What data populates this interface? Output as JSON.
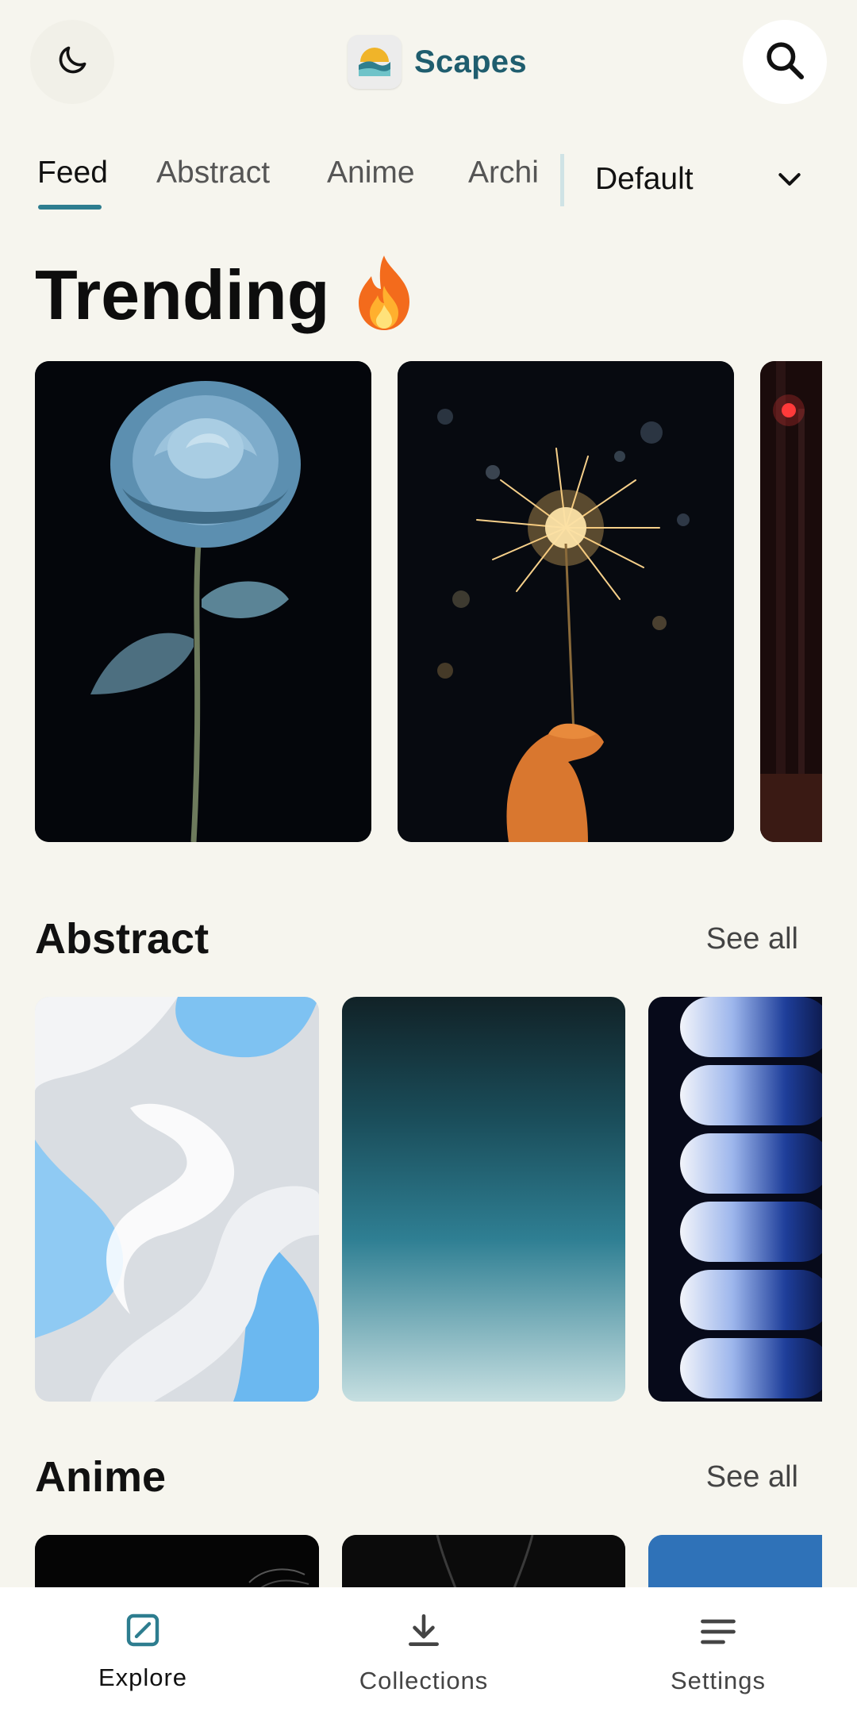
{
  "app": {
    "name": "Scapes",
    "accent": "#2d7d8f",
    "brand_color": "#1f5d6e"
  },
  "header": {
    "theme_toggle_icon": "moon-icon",
    "search_icon": "search-icon"
  },
  "tabs": {
    "items": [
      {
        "label": "Feed",
        "active": true
      },
      {
        "label": "Abstract",
        "active": false
      },
      {
        "label": "Anime",
        "active": false
      },
      {
        "label": "Archi",
        "active": false
      }
    ],
    "sort": {
      "selected": "Default",
      "icon": "chevron-down-icon"
    }
  },
  "trending": {
    "title": "Trending",
    "emoji_icon": "fire-icon",
    "cards": [
      {
        "subject": "blue rose on black background"
      },
      {
        "subject": "hand holding sparkler at night"
      },
      {
        "subject": "dark red scene (cropped)"
      }
    ]
  },
  "sections": [
    {
      "title": "Abstract",
      "see_all": "See all",
      "cards": [
        {
          "subject": "white and blue wavy layers"
        },
        {
          "subject": "teal gradient"
        },
        {
          "subject": "blue glowing ribbed tubes (cropped)"
        }
      ]
    },
    {
      "title": "Anime",
      "see_all": "See all",
      "cards": [
        {
          "subject": "dark artwork (partially visible)"
        },
        {
          "subject": "dark artwork (partially visible)"
        },
        {
          "subject": "blue artwork (partially visible)"
        }
      ]
    }
  ],
  "bottom_nav": {
    "items": [
      {
        "label": "Explore",
        "icon": "explore-icon",
        "active": true
      },
      {
        "label": "Collections",
        "icon": "download-icon",
        "active": false
      },
      {
        "label": "Settings",
        "icon": "menu-icon",
        "active": false
      }
    ]
  }
}
